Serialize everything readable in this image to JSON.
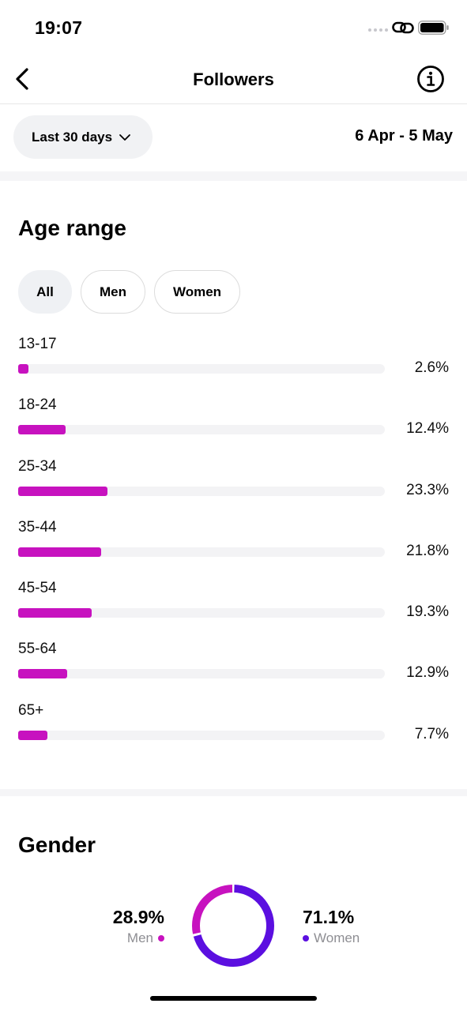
{
  "status_bar": {
    "time": "19:07"
  },
  "header": {
    "title": "Followers"
  },
  "filter": {
    "period_label": "Last 30 days",
    "date_range": "6 Apr - 5 May"
  },
  "age_range": {
    "title": "Age range",
    "chips": [
      {
        "label": "All",
        "selected": true
      },
      {
        "label": "Men",
        "selected": false
      },
      {
        "label": "Women",
        "selected": false
      }
    ],
    "bar_color": "#c712bf",
    "rows": [
      {
        "label": "13-17",
        "value_text": "2.6%",
        "value": 2.6
      },
      {
        "label": "18-24",
        "value_text": "12.4%",
        "value": 12.4
      },
      {
        "label": "25-34",
        "value_text": "23.3%",
        "value": 23.3
      },
      {
        "label": "35-44",
        "value_text": "21.8%",
        "value": 21.8
      },
      {
        "label": "45-54",
        "value_text": "19.3%",
        "value": 19.3
      },
      {
        "label": "55-64",
        "value_text": "12.9%",
        "value": 12.9
      },
      {
        "label": "65+",
        "value_text": "7.7%",
        "value": 7.7
      }
    ]
  },
  "gender": {
    "title": "Gender",
    "men": {
      "label": "Men",
      "value_text": "28.9%",
      "value": 28.9,
      "color": "#c712bf"
    },
    "women": {
      "label": "Women",
      "value_text": "71.1%",
      "value": 71.1,
      "color": "#5b0fe0"
    }
  }
}
